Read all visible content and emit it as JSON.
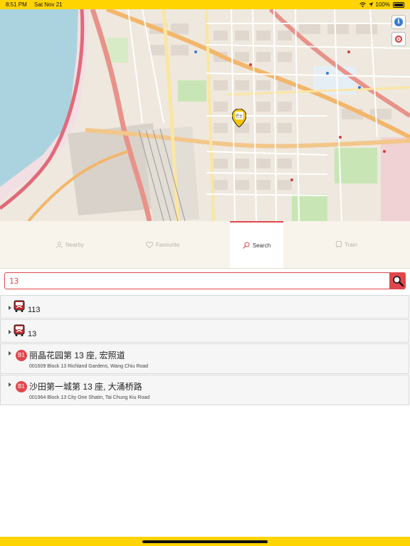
{
  "status_bar": {
    "time": "8:51 PM",
    "date": "Sat Nov 21",
    "battery": "100%",
    "icons": [
      "wifi-icon",
      "location-arrow-icon",
      "battery-icon"
    ]
  },
  "map": {
    "marker_label": "巴士",
    "buttons": [
      {
        "name": "info-button",
        "icon": "info-icon"
      },
      {
        "name": "locate-button",
        "icon": "target-icon"
      }
    ]
  },
  "tabs": [
    {
      "label": "Nearby",
      "icon": "person-icon",
      "active": false
    },
    {
      "label": "Favourite",
      "icon": "heart-icon",
      "active": false
    },
    {
      "label": "Search",
      "icon": "search-icon",
      "active": true
    },
    {
      "label": "Train",
      "icon": "train-icon",
      "active": false
    }
  ],
  "search": {
    "value": "13",
    "button_icon": "magnifier-icon"
  },
  "results": [
    {
      "type": "route",
      "icon": "bus-icon",
      "route": "113"
    },
    {
      "type": "route",
      "icon": "bus-icon",
      "route": "13"
    },
    {
      "type": "stop",
      "badge": "B1",
      "name": "丽晶花园第 13 座, 宏照道",
      "detail": "001609 Block 13 Richland Gardens, Wang Chiu Road"
    },
    {
      "type": "stop",
      "badge": "B1",
      "name": "沙田第一城第 13 座, 大涌桥路",
      "detail": "001964 Block 13 City One Shatin, Tai Chung Kiu Road"
    }
  ],
  "colors": {
    "accent": "#e0474c",
    "status_bar": "#ffd400",
    "tab_bar_bg": "#f8f4ec",
    "marker": "#f5c400"
  }
}
